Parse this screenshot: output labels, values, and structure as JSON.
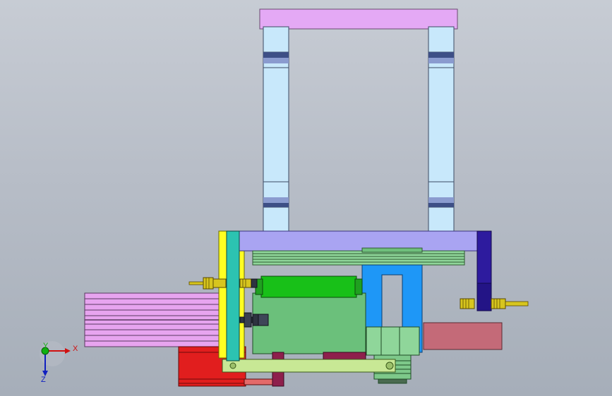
{
  "viewport": {
    "background_top": "#c7ccd4",
    "background_bottom": "#a6aeb9"
  },
  "colors": {
    "frame_top": "#e4a9f5",
    "column": "#c8e8fb",
    "column_dark": "#7a8cc0",
    "plate": "#a9a4f2",
    "yellow": "#ffff22",
    "teal": "#2cc3b1",
    "green_block": "#6bc07b",
    "bright_green": "#18c018",
    "blue": "#1e97f7",
    "navy": "#2d1b9e",
    "pink": "#c46a78",
    "cylinder": "#e7a4ef",
    "red": "#e11e1e",
    "arm": "#c8e895",
    "sensor": "#d7c51e",
    "maroon": "#8e1f4c"
  },
  "triad": {
    "x_label": "X",
    "y_label": "Y",
    "z_label": "Z",
    "x_color": "#d01010",
    "y_color": "#10b010",
    "z_color": "#1020c0"
  }
}
